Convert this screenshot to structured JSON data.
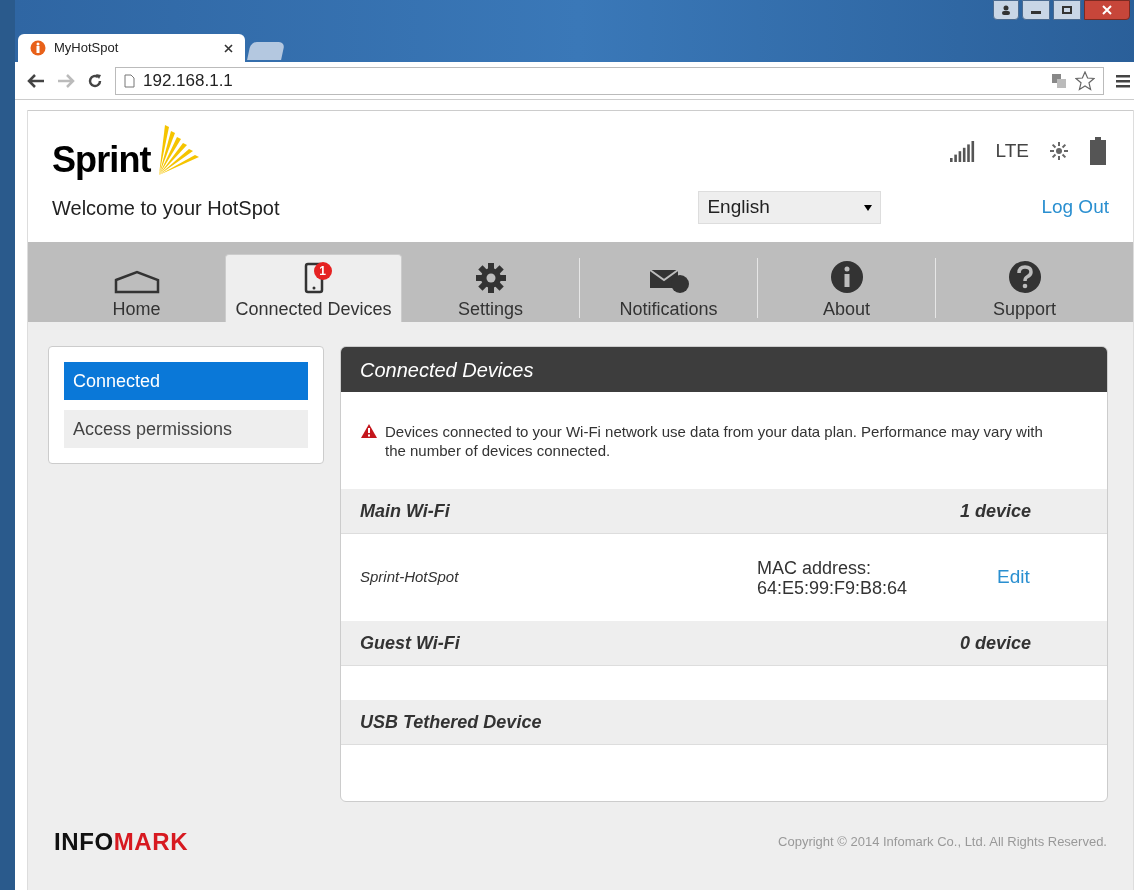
{
  "browser": {
    "tab_title": "MyHotSpot",
    "url": "192.168.1.1"
  },
  "header": {
    "brand": "Sprint",
    "welcome": "Welcome to your HotSpot",
    "network": "LTE",
    "language": "English",
    "logout": "Log Out"
  },
  "nav": [
    {
      "label": "Home",
      "kind": "home",
      "selected": false
    },
    {
      "label": "Connected Devices",
      "kind": "devices",
      "selected": true,
      "badge": "1"
    },
    {
      "label": "Settings",
      "kind": "settings",
      "selected": false
    },
    {
      "label": "Notifications",
      "kind": "notifications",
      "selected": false
    },
    {
      "label": "About",
      "kind": "about",
      "selected": false
    },
    {
      "label": "Support",
      "kind": "support",
      "selected": false
    }
  ],
  "sidebar": {
    "items": [
      {
        "label": "Connected",
        "selected": true
      },
      {
        "label": "Access permissions",
        "selected": false
      }
    ]
  },
  "panel": {
    "title": "Connected Devices",
    "warning": "Devices connected to your Wi-Fi network use data from your data plan. Performance may vary with the number of devices connected.",
    "sections": [
      {
        "title": "Main Wi-Fi",
        "count": "1 device",
        "devices": [
          {
            "name": "Sprint-HotSpot",
            "mac_label": "MAC address:",
            "mac": "64:E5:99:F9:B8:64",
            "action": "Edit"
          }
        ]
      },
      {
        "title": "Guest Wi-Fi",
        "count": "0 device"
      },
      {
        "title": "USB Tethered Device"
      }
    ]
  },
  "footer": {
    "logo_dark": "INFO",
    "logo_accent": "MARK",
    "copyright": "Copyright © 2014 Infomark Co., Ltd. All Rights Reserved."
  }
}
